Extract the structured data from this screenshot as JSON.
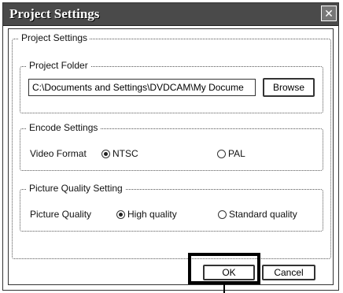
{
  "window": {
    "title": "Project Settings",
    "close_glyph": "✕"
  },
  "project_settings_group": {
    "title": "Project Settings"
  },
  "project_folder": {
    "title": "Project Folder",
    "path_value": "C:\\Documents and Settings\\DVDCAM\\My Docume",
    "browse_label": "Browse"
  },
  "encode_settings": {
    "title": "Encode Settings",
    "label": "Video Format",
    "options": [
      {
        "label": "NTSC",
        "selected": true
      },
      {
        "label": "PAL",
        "selected": false
      }
    ]
  },
  "picture_quality_setting": {
    "title": "Picture Quality Setting",
    "label": "Picture Quality",
    "options": [
      {
        "label": "High quality",
        "selected": true
      },
      {
        "label": "Standard quality",
        "selected": false
      }
    ]
  },
  "buttons": {
    "ok_label": "OK",
    "cancel_label": "Cancel"
  }
}
